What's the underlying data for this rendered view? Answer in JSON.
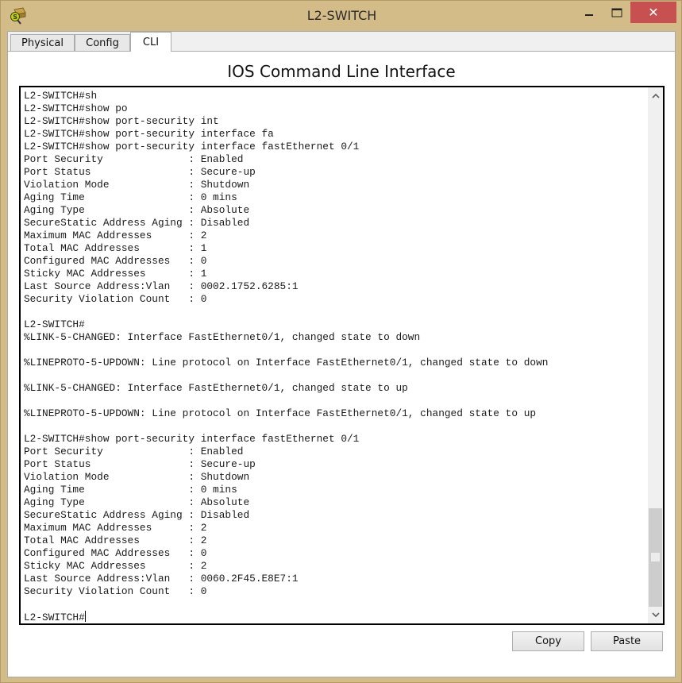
{
  "window": {
    "title": "L2-SWITCH",
    "icon": "packet-tracer-switch-icon",
    "controls": {
      "minimize": "minimize-icon",
      "maximize": "maximize-icon",
      "close_glyph": "✕"
    }
  },
  "tabs": [
    {
      "label": "Physical",
      "active": false
    },
    {
      "label": "Config",
      "active": false
    },
    {
      "label": "CLI",
      "active": true
    }
  ],
  "heading": "IOS Command Line Interface",
  "terminal": {
    "lines": [
      "L2-SWITCH#sh",
      "L2-SWITCH#show po",
      "L2-SWITCH#show port-security int",
      "L2-SWITCH#show port-security interface fa",
      "L2-SWITCH#show port-security interface fastEthernet 0/1",
      "Port Security              : Enabled",
      "Port Status                : Secure-up",
      "Violation Mode             : Shutdown",
      "Aging Time                 : 0 mins",
      "Aging Type                 : Absolute",
      "SecureStatic Address Aging : Disabled",
      "Maximum MAC Addresses      : 2",
      "Total MAC Addresses        : 1",
      "Configured MAC Addresses   : 0",
      "Sticky MAC Addresses       : 1",
      "Last Source Address:Vlan   : 0002.1752.6285:1",
      "Security Violation Count   : 0",
      "",
      "L2-SWITCH#",
      "%LINK-5-CHANGED: Interface FastEthernet0/1, changed state to down",
      "",
      "%LINEPROTO-5-UPDOWN: Line protocol on Interface FastEthernet0/1, changed state to down",
      "",
      "%LINK-5-CHANGED: Interface FastEthernet0/1, changed state to up",
      "",
      "%LINEPROTO-5-UPDOWN: Line protocol on Interface FastEthernet0/1, changed state to up",
      "",
      "L2-SWITCH#show port-security interface fastEthernet 0/1",
      "Port Security              : Enabled",
      "Port Status                : Secure-up",
      "Violation Mode             : Shutdown",
      "Aging Time                 : 0 mins",
      "Aging Type                 : Absolute",
      "SecureStatic Address Aging : Disabled",
      "Maximum MAC Addresses      : 2",
      "Total MAC Addresses        : 2",
      "Configured MAC Addresses   : 0",
      "Sticky MAC Addresses       : 2",
      "Last Source Address:Vlan   : 0060.2F45.E8E7:1",
      "Security Violation Count   : 0",
      ""
    ],
    "prompt": "L2-SWITCH#",
    "scroll_position_fraction": 1.0
  },
  "buttons": {
    "copy": "Copy",
    "paste": "Paste"
  },
  "colors": {
    "frame": "#d4bc88",
    "close_button": "#c75050",
    "scroll_thumb": "#cdcdcd"
  }
}
